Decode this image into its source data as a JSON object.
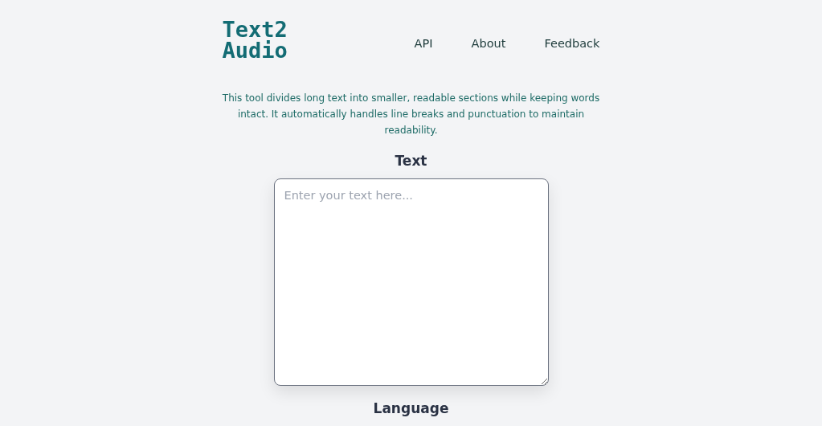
{
  "logo": {
    "lines": [
      "Text2",
      "Audio"
    ]
  },
  "nav": [
    {
      "label": "API"
    },
    {
      "label": "About"
    },
    {
      "label": "Feedback"
    }
  ],
  "description": "This tool divides long text into smaller, readable sections while keeping words intact. It automatically handles line breaks and punctuation to maintain readability.",
  "text_section": {
    "heading": "Text",
    "placeholder": "Enter your text here..."
  },
  "language_section": {
    "heading": "Language"
  }
}
